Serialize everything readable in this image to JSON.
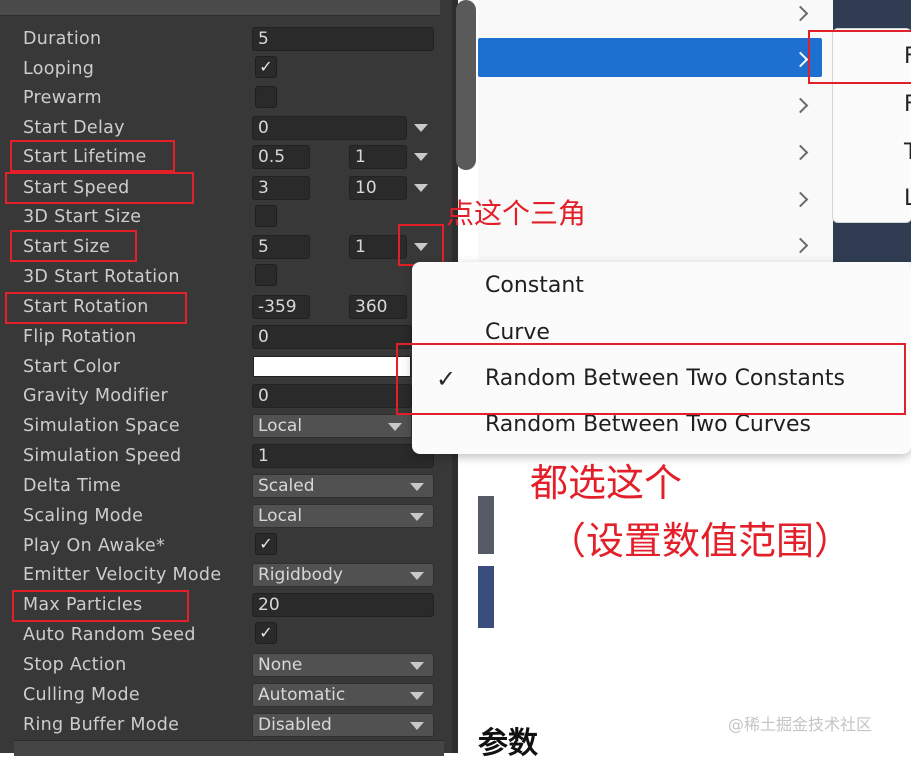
{
  "inspector": {
    "rows": [
      {
        "label": "Duration",
        "value": "5"
      },
      {
        "label": "Looping",
        "checked": true
      },
      {
        "label": "Prewarm",
        "checked": false
      },
      {
        "label": "Start Delay",
        "value": "0"
      },
      {
        "label": "Start Lifetime",
        "min": "0.5",
        "max": "1"
      },
      {
        "label": "Start Speed",
        "min": "3",
        "max": "10"
      },
      {
        "label": "3D Start Size",
        "checked": false
      },
      {
        "label": "Start Size",
        "min": "5",
        "max": "1"
      },
      {
        "label": "3D Start Rotation",
        "checked": false
      },
      {
        "label": "Start Rotation",
        "min": "-359",
        "max": "360"
      },
      {
        "label": "Flip Rotation",
        "value": "0"
      },
      {
        "label": "Start Color",
        "color": "#ffffff"
      },
      {
        "label": "Gravity Modifier",
        "value": "0"
      },
      {
        "label": "Simulation Space",
        "value": "Local"
      },
      {
        "label": "Simulation Speed",
        "value": "1"
      },
      {
        "label": "Delta Time",
        "value": "Scaled"
      },
      {
        "label": "Scaling Mode",
        "value": "Local"
      },
      {
        "label": "Play On Awake*",
        "checked": true
      },
      {
        "label": "Emitter Velocity Mode",
        "value": "Rigidbody"
      },
      {
        "label": "Max Particles",
        "value": "20"
      },
      {
        "label": "Auto Random Seed",
        "checked": true
      },
      {
        "label": "Stop Action",
        "value": "None"
      },
      {
        "label": "Culling Mode",
        "value": "Automatic"
      },
      {
        "label": "Ring Buffer Mode",
        "value": "Disabled"
      }
    ],
    "check_glyph": "✓"
  },
  "popup": {
    "items": [
      "Constant",
      "Curve",
      "Random Between Two Constants",
      "Random Between Two Curves"
    ],
    "selected_index": 2,
    "check_glyph": "✓"
  },
  "side_menu": {
    "items": [
      "F",
      "F",
      "T",
      "L"
    ]
  },
  "annotations": {
    "triangle_hint": "点这个三角",
    "choose_this": "都选这个",
    "set_range": "（设置数值范围）"
  },
  "bottom_text": "参数",
  "watermark": "@稀土掘金技术社区",
  "colors": {
    "inspector_bg": "#383838",
    "highlight_blue": "#1d6fd0",
    "annotation_red": "#e3202a"
  },
  "icons": [
    "chevron-right-icon",
    "dropdown-triangle-icon",
    "checkmark-icon"
  ]
}
